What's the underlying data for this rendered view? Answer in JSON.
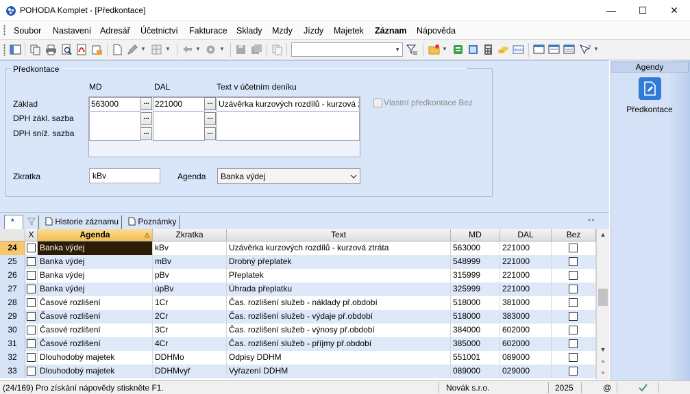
{
  "window": {
    "title": "POHODA Komplet - [Předkontace]",
    "min": "—",
    "max": "☐",
    "close": "✕"
  },
  "menu": [
    "Soubor",
    "Nastavení",
    "Adresář",
    "Účetnictví",
    "Fakturace",
    "Sklady",
    "Mzdy",
    "Jízdy",
    "Majetek",
    "Záznam",
    "Nápověda"
  ],
  "toolbar": {
    "combo_value": ""
  },
  "form": {
    "legend": "Předkontace",
    "col_md": "MD",
    "col_dal": "DAL",
    "col_text": "Text v účetním deníku",
    "row_zaklad": "Základ",
    "row_dph_zakl": "DPH zákl. sazba",
    "row_dph_sniz": "DPH sníž. sazba",
    "md_zaklad": "563000",
    "dal_zaklad": "221000",
    "text_zaklad": "Uzávěrka kurzových rozdílů - kurzová ztráta",
    "md_dph_zakl": "",
    "dal_dph_zakl": "",
    "text_dph_zakl": "",
    "md_dph_sniz": "",
    "dal_dph_sniz": "",
    "text_dph_sniz": "",
    "ellipsis": "...",
    "vlastni_label": "Vlastní předkontace Bez",
    "zkratka_label": "Zkratka",
    "zkratka_value": "kBv",
    "agenda_label": "Agenda",
    "agenda_value": "Banka výdej"
  },
  "agenda_panel": {
    "header": "Agendy",
    "tile_label": "Předkontace"
  },
  "tabs": {
    "star": "*",
    "historie": "Historie záznamu",
    "poznamky": "Poznámky",
    "nav": "◂ ▸"
  },
  "grid": {
    "headers": {
      "x": "X",
      "agenda": "Agenda",
      "zkratka": "Zkratka",
      "text": "Text",
      "md": "MD",
      "dal": "DAL",
      "bez": "Bez"
    },
    "rows": [
      {
        "n": "24",
        "agenda": "Banka výdej",
        "zkratka": "kBv",
        "text": "Uzávěrka kurzových rozdílů - kurzová ztráta",
        "md": "563000",
        "dal": "221000"
      },
      {
        "n": "25",
        "agenda": "Banka výdej",
        "zkratka": "mBv",
        "text": "Drobný přeplatek",
        "md": "548999",
        "dal": "221000"
      },
      {
        "n": "26",
        "agenda": "Banka výdej",
        "zkratka": "pBv",
        "text": "Přeplatek",
        "md": "315999",
        "dal": "221000"
      },
      {
        "n": "27",
        "agenda": "Banka výdej",
        "zkratka": "úpBv",
        "text": "Úhrada přeplatku",
        "md": "325999",
        "dal": "221000"
      },
      {
        "n": "28",
        "agenda": "Časové rozlišení",
        "zkratka": "1Cr",
        "text": "Čas. rozlišení služeb - náklady př.období",
        "md": "518000",
        "dal": "381000"
      },
      {
        "n": "29",
        "agenda": "Časové rozlišení",
        "zkratka": "2Cr",
        "text": "Čas. rozlišení služeb - výdaje př.období",
        "md": "518000",
        "dal": "383000"
      },
      {
        "n": "30",
        "agenda": "Časové rozlišení",
        "zkratka": "3Cr",
        "text": "Čas. rozlišení služeb - výnosy př.období",
        "md": "384000",
        "dal": "602000"
      },
      {
        "n": "31",
        "agenda": "Časové rozlišení",
        "zkratka": "4Cr",
        "text": "Čas. rozlišení služeb - příjmy př.období",
        "md": "385000",
        "dal": "602000"
      },
      {
        "n": "32",
        "agenda": "Dlouhodobý majetek",
        "zkratka": "DDHMo",
        "text": "Odpisy DDHM",
        "md": "551001",
        "dal": "089000"
      },
      {
        "n": "33",
        "agenda": "Dlouhodobý majetek",
        "zkratka": "DDHMvyř",
        "text": "Vyřazení DDHM",
        "md": "089000",
        "dal": "029000"
      }
    ]
  },
  "status": {
    "left": "(24/169) Pro získání nápovědy stiskněte F1.",
    "company": "Novák s.r.o.",
    "year": "2025",
    "at": "@"
  },
  "colors": {
    "selected_row": "#2b1c05",
    "header_active": "#f7c86b",
    "alt_row": "#dde8f8",
    "tile": "#2f7bd6"
  }
}
